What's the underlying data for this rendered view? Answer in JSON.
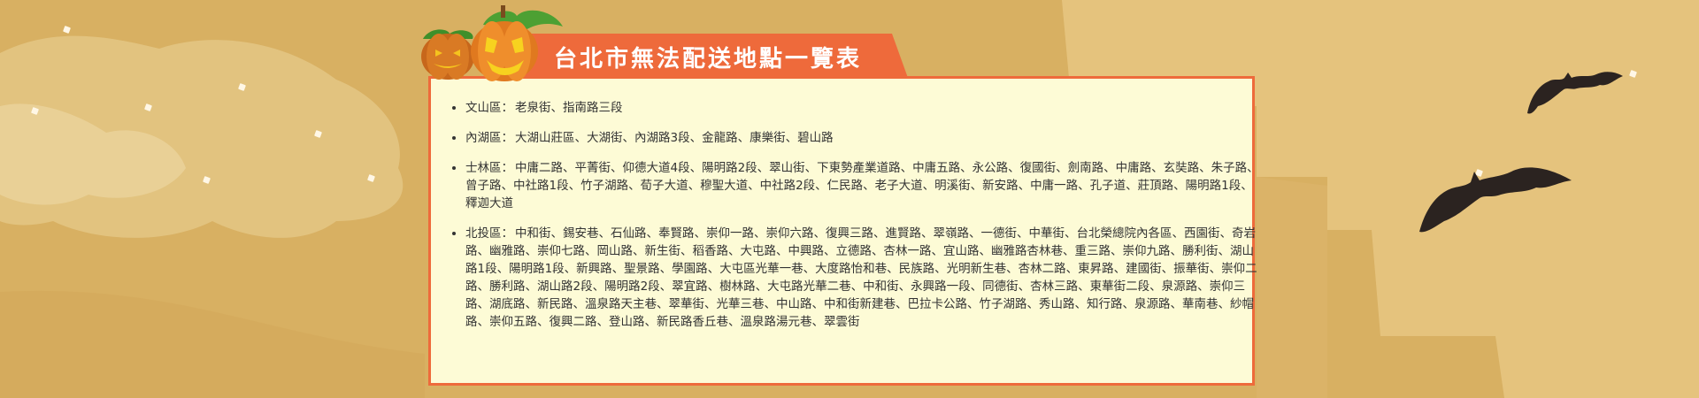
{
  "page": {
    "title": "台北市無法配送地點一覽表",
    "colors": {
      "background": "#d8b062",
      "banner": "#ee6a3b",
      "card": "#fdfbd6",
      "text": "#333333"
    },
    "decorations": [
      "pumpkin-icon",
      "bat-icon"
    ]
  },
  "districts": [
    {
      "district": "文山區",
      "separator": "：",
      "places": "老泉街、指南路三段"
    },
    {
      "district": "內湖區",
      "separator": "：",
      "places": "大湖山莊區、大湖街、內湖路3段、金龍路、康樂街、碧山路"
    },
    {
      "district": "士林區",
      "separator": "：",
      "places": "中庸二路、平菁街、仰德大道4段、陽明路2段、翠山街、下東勢產業道路、中庸五路、永公路、復國街、劍南路、中庸路、玄奘路、朱子路、曾子路、中社路1段、竹子湖路、荀子大道、穆聖大道、中社路2段、仁民路、老子大道、明溪街、新安路、中庸一路、孔子道、莊頂路、陽明路1段、釋迦大道"
    },
    {
      "district": "北投區",
      "separator": "：",
      "places": "中和街、錫安巷、石仙路、奉賢路、崇仰一路、崇仰六路、復興三路、進賢路、翠嶺路、一德街、中華街、台北榮總院內各區、西園街、奇岩路、幽雅路、崇仰七路、岡山路、新生街、稻香路、大屯路、中興路、立德路、杏林一路、宜山路、幽雅路杏林巷、重三路、崇仰九路、勝利街、湖山路1段、陽明路1段、新興路、聖景路、學園路、大屯區光華一巷、大度路怡和巷、民族路、光明新生巷、杏林二路、東昇路、建國街、振華街、崇仰二路、勝利路、湖山路2段、陽明路2段、翠宜路、樹林路、大屯路光華二巷、中和街、永興路一段、同德街、杏林三路、東華街二段、泉源路、崇仰三路、湖底路、新民路、溫泉路天主巷、翠華街、光華三巷、中山路、中和街新建巷、巴拉卡公路、竹子湖路、秀山路、知行路、泉源路、華南巷、紗帽路、崇仰五路、復興二路、登山路、新民路香丘巷、溫泉路湯元巷、翠雲街"
    }
  ]
}
